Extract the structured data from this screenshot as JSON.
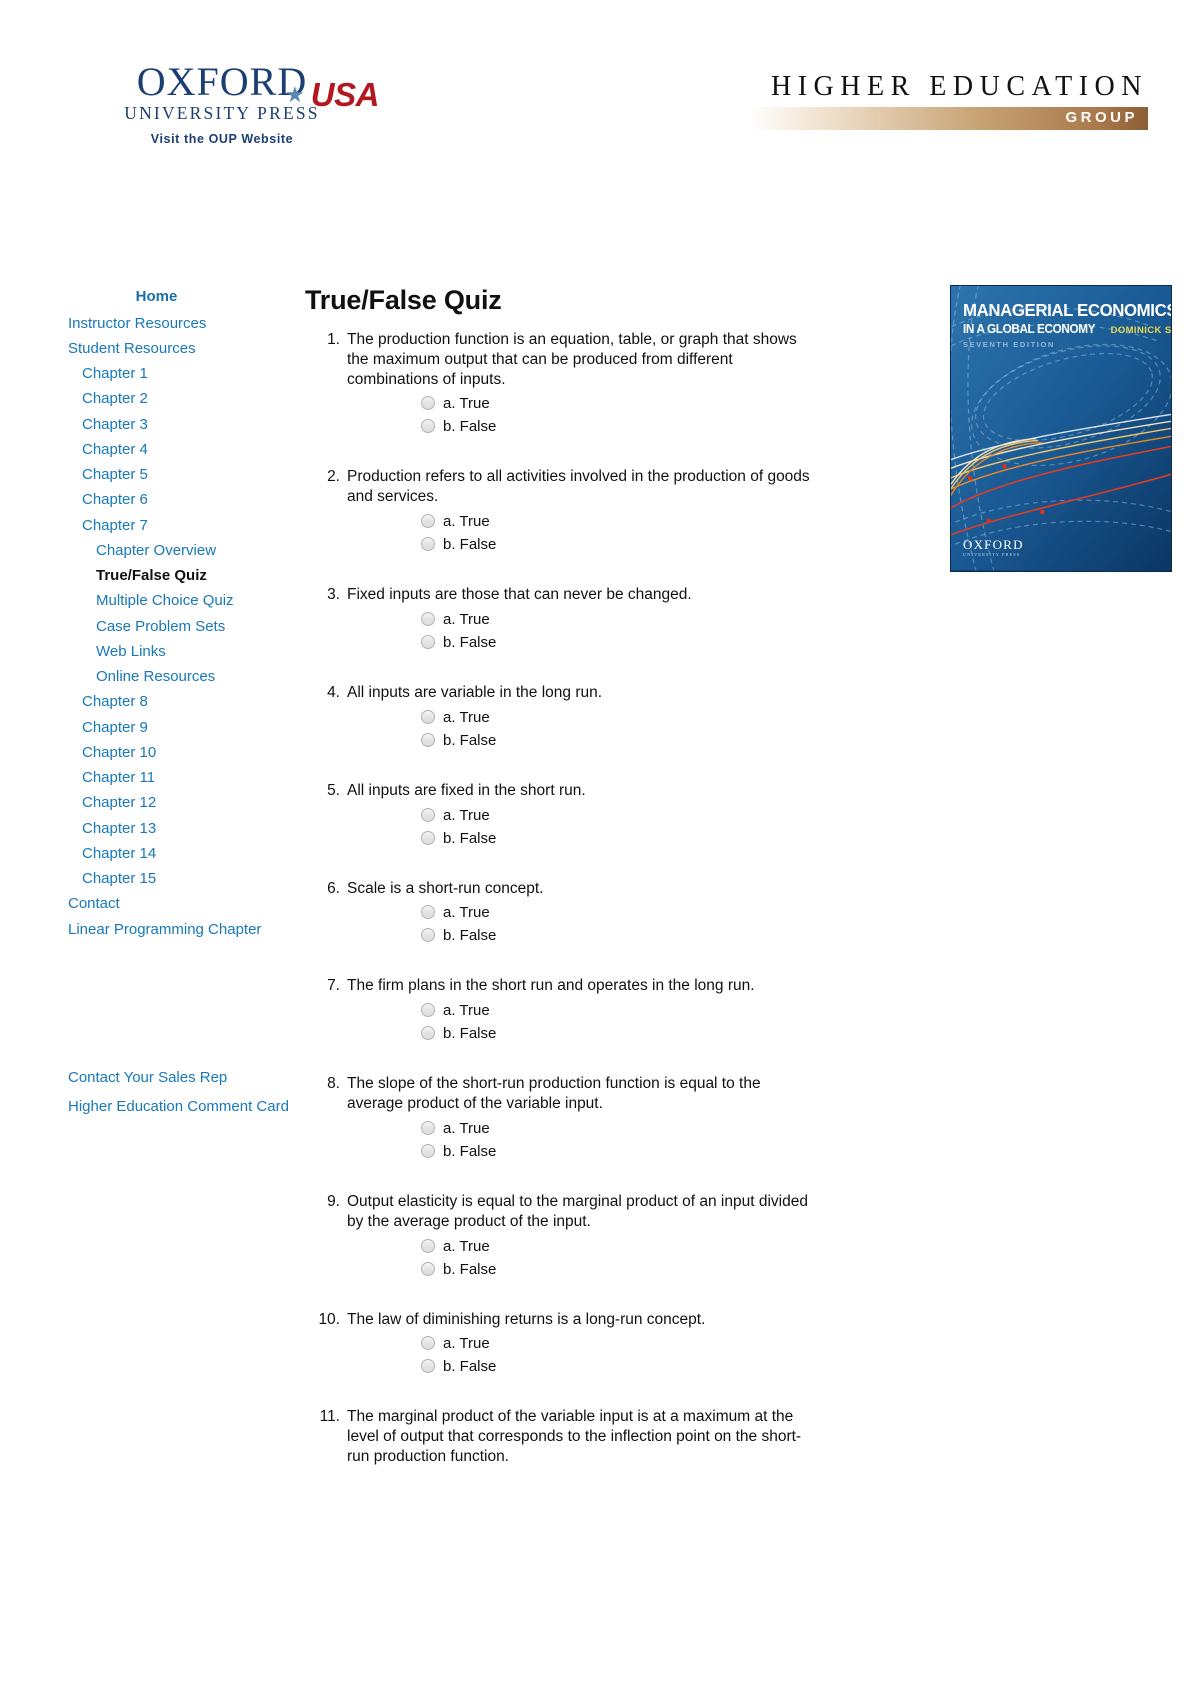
{
  "header": {
    "oup_logo": {
      "line1": "OXFORD",
      "line2": "UNIVERSITY PRESS",
      "line3": "Visit the OUP Website",
      "usa": "USA",
      "star_icon": "star-icon"
    },
    "heg_logo": {
      "title": "HIGHER EDUCATION",
      "group": "GROUP"
    }
  },
  "sidebar": {
    "home_label": "Home",
    "items": [
      {
        "label": "Instructor Resources",
        "level": 0,
        "current": false
      },
      {
        "label": "Student Resources",
        "level": 0,
        "current": false
      },
      {
        "label": "Chapter 1",
        "level": 1,
        "current": false
      },
      {
        "label": "Chapter 2",
        "level": 1,
        "current": false
      },
      {
        "label": "Chapter 3",
        "level": 1,
        "current": false
      },
      {
        "label": "Chapter 4",
        "level": 1,
        "current": false
      },
      {
        "label": "Chapter 5",
        "level": 1,
        "current": false
      },
      {
        "label": "Chapter 6",
        "level": 1,
        "current": false
      },
      {
        "label": "Chapter 7",
        "level": 1,
        "current": false
      },
      {
        "label": "Chapter Overview",
        "level": 2,
        "current": false
      },
      {
        "label": "True/False Quiz",
        "level": 2,
        "current": true
      },
      {
        "label": "Multiple Choice Quiz",
        "level": 2,
        "current": false
      },
      {
        "label": "Case Problem Sets",
        "level": 2,
        "current": false
      },
      {
        "label": "Web Links",
        "level": 2,
        "current": false
      },
      {
        "label": "Online Resources",
        "level": 2,
        "current": false
      },
      {
        "label": "Chapter 8",
        "level": 1,
        "current": false
      },
      {
        "label": "Chapter 9",
        "level": 1,
        "current": false
      },
      {
        "label": "Chapter 10",
        "level": 1,
        "current": false
      },
      {
        "label": "Chapter 11",
        "level": 1,
        "current": false
      },
      {
        "label": "Chapter 12",
        "level": 1,
        "current": false
      },
      {
        "label": "Chapter 13",
        "level": 1,
        "current": false
      },
      {
        "label": "Chapter 14",
        "level": 1,
        "current": false
      },
      {
        "label": "Chapter 15",
        "level": 1,
        "current": false
      },
      {
        "label": "Contact",
        "level": 0,
        "current": false
      },
      {
        "label": "Linear Programming Chapter",
        "level": 0,
        "current": false
      }
    ],
    "footer_links": [
      {
        "label": "Contact Your Sales Rep"
      },
      {
        "label": "Higher Education Comment Card"
      }
    ]
  },
  "main": {
    "title": "True/False Quiz",
    "questions": [
      {
        "number": "1.",
        "text": "The production function is an equation, table, or graph that shows the maximum output that can be produced from different combinations of inputs.",
        "choices": [
          "a. True",
          "b. False"
        ]
      },
      {
        "number": "2.",
        "text": "Production refers to all activities involved in the production of goods and services.",
        "choices": [
          "a. True",
          "b. False"
        ]
      },
      {
        "number": "3.",
        "text": "Fixed inputs are those that can never be changed.",
        "choices": [
          "a. True",
          "b. False"
        ]
      },
      {
        "number": "4.",
        "text": "All inputs are variable in the long run.",
        "choices": [
          "a. True",
          "b. False"
        ]
      },
      {
        "number": "5.",
        "text": "All inputs are fixed in the short run.",
        "choices": [
          "a. True",
          "b. False"
        ]
      },
      {
        "number": "6.",
        "text": "Scale is a short-run concept.",
        "choices": [
          "a. True",
          "b. False"
        ]
      },
      {
        "number": "7.",
        "text": "The firm plans in the short run and operates in the long run.",
        "choices": [
          "a. True",
          "b. False"
        ]
      },
      {
        "number": "8.",
        "text": "The slope of the short-run production function is equal to the average product of the variable input.",
        "choices": [
          "a. True",
          "b. False"
        ]
      },
      {
        "number": "9.",
        "text": "Output elasticity is equal to the marginal product of an input divided by the average product of the input.",
        "choices": [
          "a. True",
          "b. False"
        ]
      },
      {
        "number": "10.",
        "text": "The law of diminishing returns is a long-run concept.",
        "choices": [
          "a. True",
          "b. False"
        ]
      },
      {
        "number": "11.",
        "text": "The marginal product of the variable input is at a maximum at the level of output that corresponds to the inflection point on the short-run production function.",
        "choices": []
      }
    ]
  },
  "book_cover": {
    "title": "MANAGERIAL ECONOMICS",
    "subtitle": "IN A GLOBAL ECONOMY",
    "author": "DOMINICK SALVATORE",
    "edition": "SEVENTH EDITION",
    "publisher": "OXFORD",
    "publisher_sub": "UNIVERSITY PRESS"
  },
  "colors": {
    "link": "#1878b8",
    "link_home": "#1a6fa8",
    "text": "#111111",
    "heg_bar": "#a9784a",
    "usa_red": "#b3171f",
    "oup_blue": "#1c3f73"
  }
}
